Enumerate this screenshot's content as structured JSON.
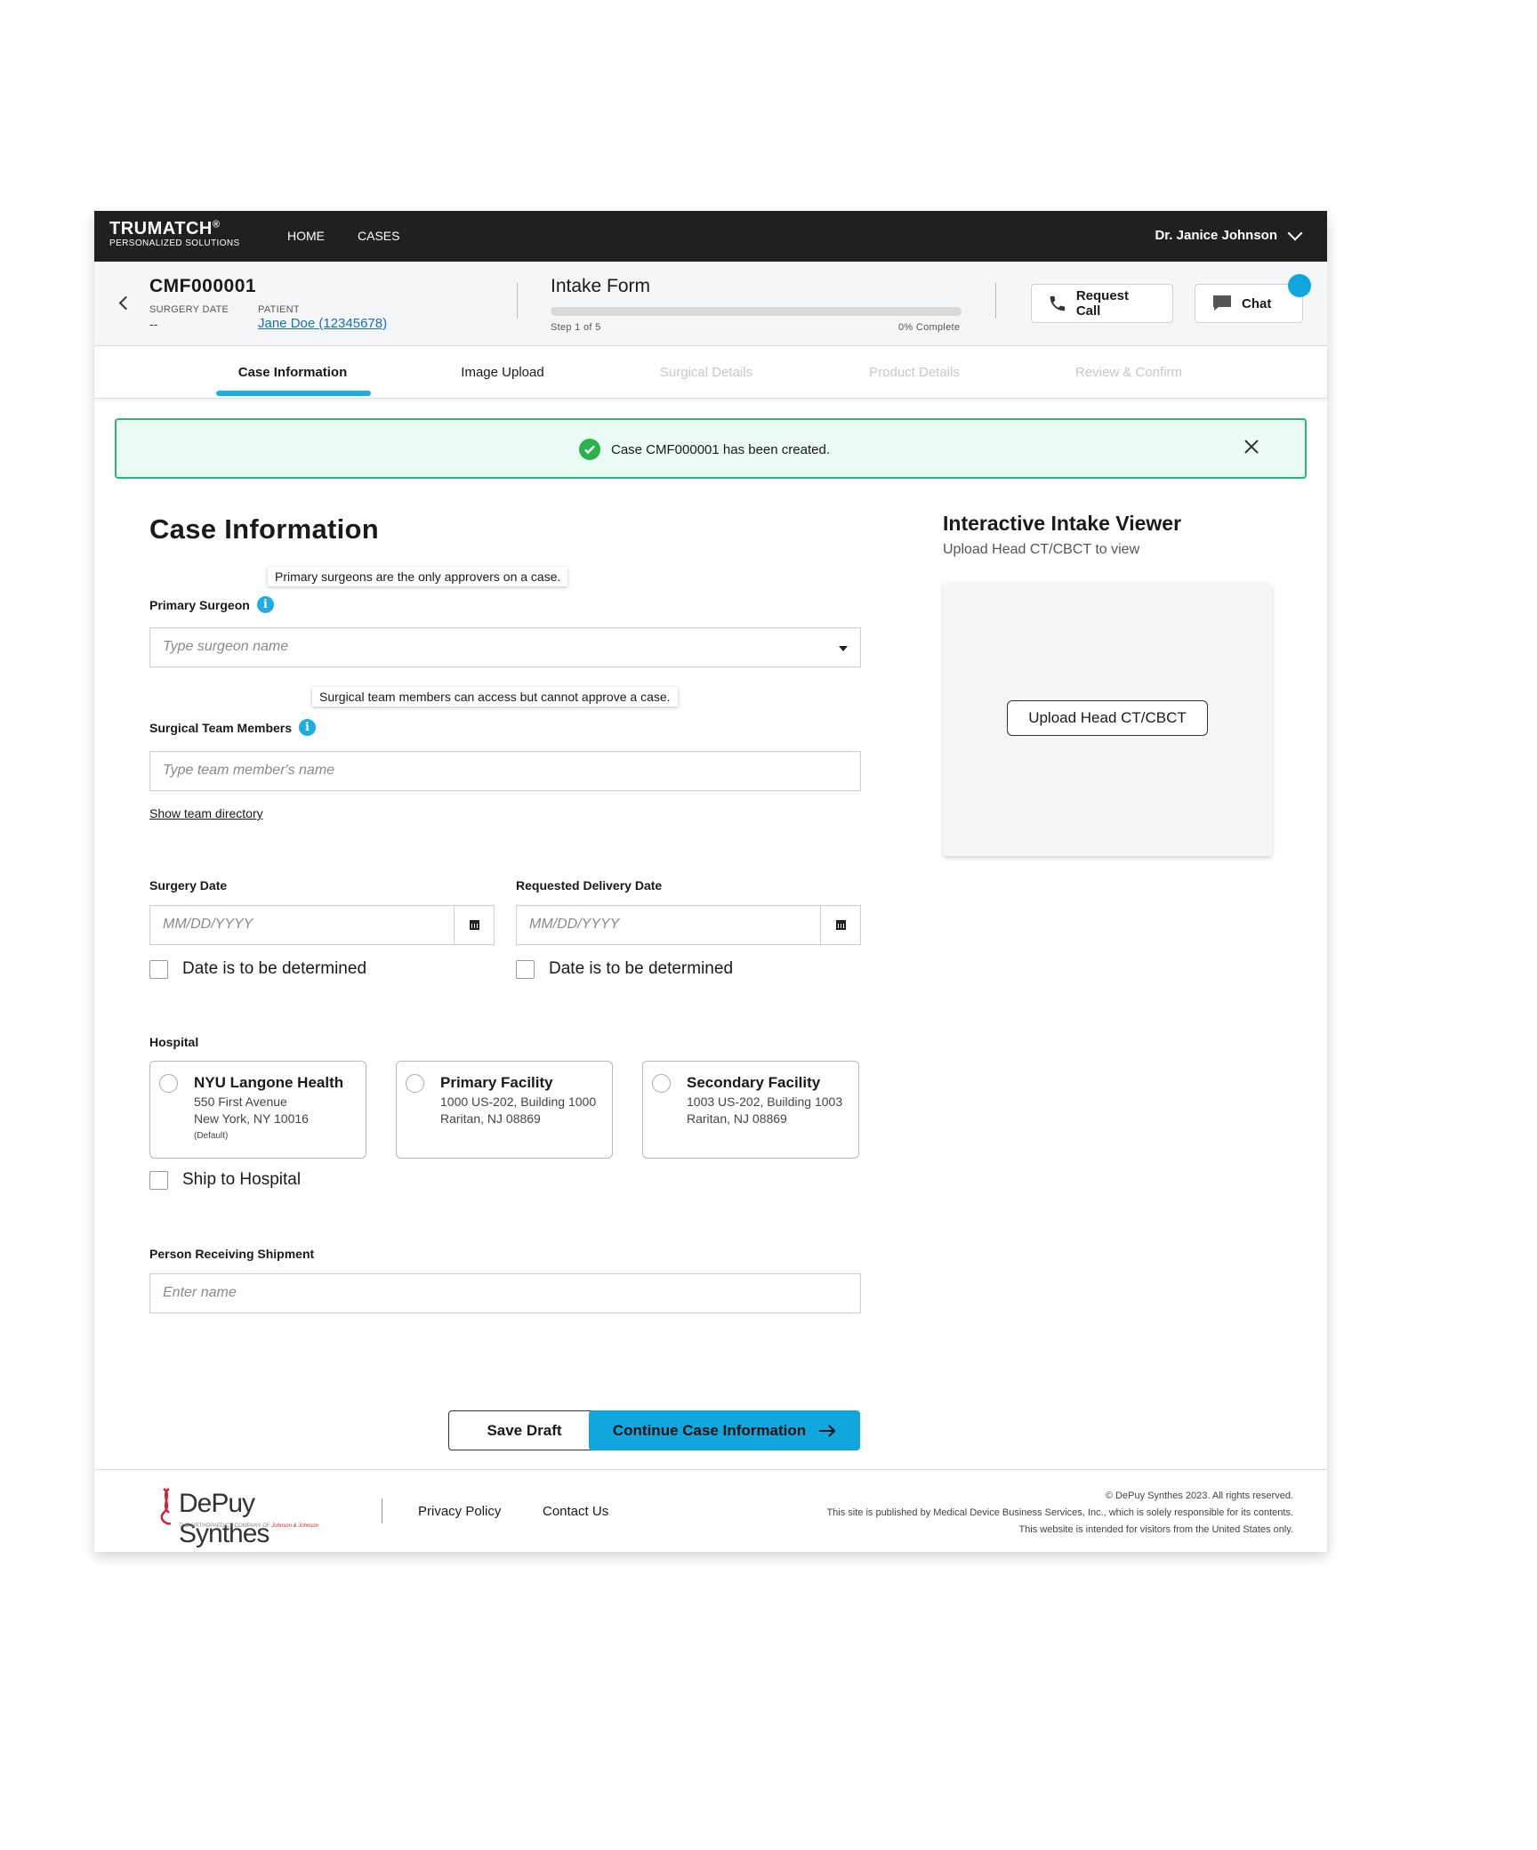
{
  "nav": {
    "brand": "TRUMATCH",
    "brand_mark": "®",
    "brand_sub": "PERSONALIZED SOLUTIONS",
    "links": [
      "HOME",
      "CASES"
    ],
    "user": "Dr. Janice Johnson"
  },
  "case": {
    "id": "CMF000001",
    "surgery_date_label": "SURGERY DATE",
    "surgery_date_value": "--",
    "patient_label": "PATIENT",
    "patient_value": "Jane Doe (12345678)"
  },
  "intake": {
    "title": "Intake Form",
    "step": "Step 1 of 5",
    "percent_text": "0% Complete",
    "progress": 0
  },
  "actions": {
    "request_call": "Request Call",
    "chat": "Chat"
  },
  "tabs": [
    {
      "label": "Case Information",
      "state": "active"
    },
    {
      "label": "Image Upload",
      "state": "enabled"
    },
    {
      "label": "Surgical Details",
      "state": "disabled"
    },
    {
      "label": "Product Details",
      "state": "disabled"
    },
    {
      "label": "Review & Confirm",
      "state": "disabled"
    }
  ],
  "alert": {
    "message": "Case CMF000001 has been created."
  },
  "form": {
    "title": "Case Information",
    "primary_surgeon": {
      "tooltip": "Primary surgeons are the only approvers on a case.",
      "label": "Primary Surgeon",
      "placeholder": "Type surgeon name"
    },
    "team": {
      "tooltip": "Surgical team members can access but cannot approve a case.",
      "label": "Surgical Team Members",
      "placeholder": "Type team member's name",
      "directory_link": "Show team directory"
    },
    "surgery_date": {
      "label": "Surgery Date",
      "placeholder": "MM/DD/YYYY",
      "tbd": "Date is to be determined"
    },
    "delivery_date": {
      "label": "Requested Delivery Date",
      "placeholder": "MM/DD/YYYY",
      "tbd": "Date is to be determined"
    },
    "hospital": {
      "label": "Hospital",
      "options": [
        {
          "name": "NYU Langone Health",
          "line1": "550 First Avenue",
          "line2": "New York, NY 10016",
          "note": "(Default)"
        },
        {
          "name": "Primary Facility",
          "line1": "1000 US-202, Building 1000",
          "line2": "Raritan, NJ 08869",
          "note": ""
        },
        {
          "name": "Secondary Facility",
          "line1": "1003 US-202, Building 1003",
          "line2": "Raritan, NJ 08869",
          "note": ""
        }
      ],
      "ship_label": "Ship to Hospital"
    },
    "receiver": {
      "label": "Person Receiving Shipment",
      "placeholder": "Enter name"
    },
    "save_draft": "Save Draft",
    "continue": "Continue Case Information"
  },
  "viewer": {
    "title": "Interactive Intake Viewer",
    "subtitle": "Upload Head CT/CBCT to view",
    "upload_button": "Upload Head CT/CBCT"
  },
  "footer": {
    "brand": "DePuy Synthes",
    "brand_tag": "THE ORTHOPAEDICS COMPANY OF",
    "brand_parent": "Johnson & Johnson",
    "links": [
      "Privacy Policy",
      "Contact Us"
    ],
    "copyright": "© DePuy Synthes 2023. All rights reserved.",
    "publisher": "This site is published by Medical Device Business Services, Inc., which is solely responsible for its contents.",
    "audience": "This website is intended for visitors from the United States only."
  },
  "colors": {
    "accent": "#12a6df",
    "nav_bg": "#202020",
    "success_border": "#2bb673",
    "success_bg": "#e9fbf4"
  }
}
